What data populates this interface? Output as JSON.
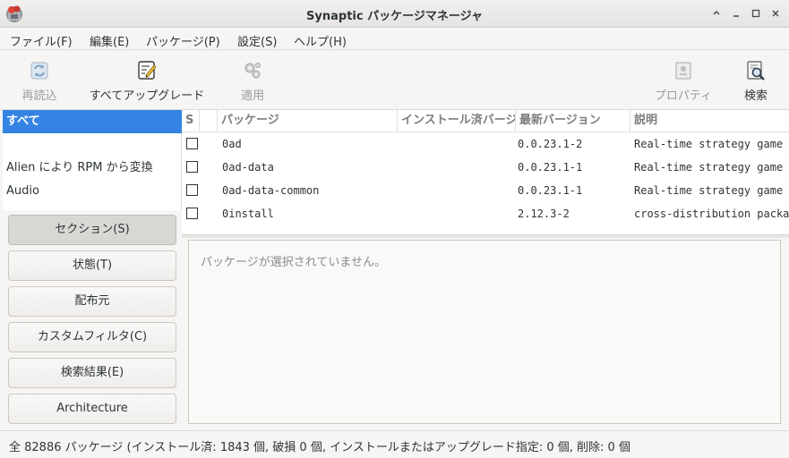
{
  "window": {
    "title": "Synaptic パッケージマネージャ"
  },
  "menubar": {
    "items": [
      "ファイル(F)",
      "編集(E)",
      "パッケージ(P)",
      "設定(S)",
      "ヘルプ(H)"
    ]
  },
  "toolbar": {
    "reload": {
      "label": "再読込",
      "icon": "reload-icon",
      "enabled": false
    },
    "upgrade_all": {
      "label": "すべてアップグレード",
      "icon": "upgrade-icon",
      "enabled": true
    },
    "apply": {
      "label": "適用",
      "icon": "gears-icon",
      "enabled": false
    },
    "properties": {
      "label": "プロパティ",
      "icon": "properties-icon",
      "enabled": false
    },
    "search": {
      "label": "検索",
      "icon": "search-icon",
      "enabled": true
    }
  },
  "categories": {
    "items": [
      "すべて",
      "",
      "Alien により RPM から変換",
      "Audio"
    ],
    "selected_index": 0
  },
  "filters": {
    "buttons": [
      "セクション(S)",
      "状態(T)",
      "配布元",
      "カスタムフィルタ(C)",
      "検索結果(E)",
      "Architecture"
    ],
    "active_index": 0
  },
  "table": {
    "columns": [
      "S",
      "パッケージ",
      "インストール済バージョン",
      "最新バージョン",
      "説明"
    ],
    "rows": [
      {
        "package": "0ad",
        "installed": "",
        "latest": "0.0.23.1-2",
        "description": "Real-time strategy game of ancient warfare"
      },
      {
        "package": "0ad-data",
        "installed": "",
        "latest": "0.0.23.1-1",
        "description": "Real-time strategy game of ancient warfare (data files)"
      },
      {
        "package": "0ad-data-common",
        "installed": "",
        "latest": "0.0.23.1-1",
        "description": "Real-time strategy game of ancient warfare (common data files)"
      },
      {
        "package": "0install",
        "installed": "",
        "latest": "2.12.3-2",
        "description": "cross-distribution packaging system"
      }
    ]
  },
  "details": {
    "placeholder": "パッケージが選択されていません。"
  },
  "statusbar": {
    "text": "全 82886 パッケージ (インストール済: 1843 個, 破損 0 個, インストールまたはアップグレード指定: 0 個, 削除: 0 個"
  },
  "colors": {
    "selection": "#3584e4",
    "window_bg": "#f6f5f4"
  }
}
